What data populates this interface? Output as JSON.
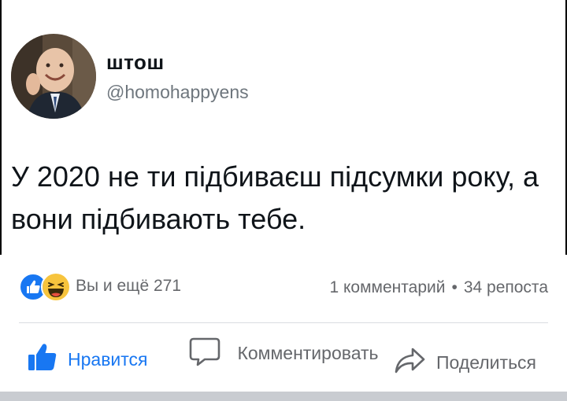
{
  "tweet": {
    "name": "штош",
    "handle": "@homohappyens",
    "text": "У 2020 не ти підбиваєш підсумки року, а вони підбивають тебе."
  },
  "reactions": {
    "icons": [
      "like-icon",
      "haha-icon"
    ],
    "count_text": "Вы и ещё 271"
  },
  "stats": {
    "comments": "1 комментарий",
    "separator": "•",
    "shares": "34 репоста"
  },
  "actions": {
    "like": "Нравится",
    "comment": "Комментировать",
    "share": "Поделиться"
  },
  "colors": {
    "accent": "#1877f2",
    "muted_text": "#65676b",
    "divider": "#dadde1"
  }
}
